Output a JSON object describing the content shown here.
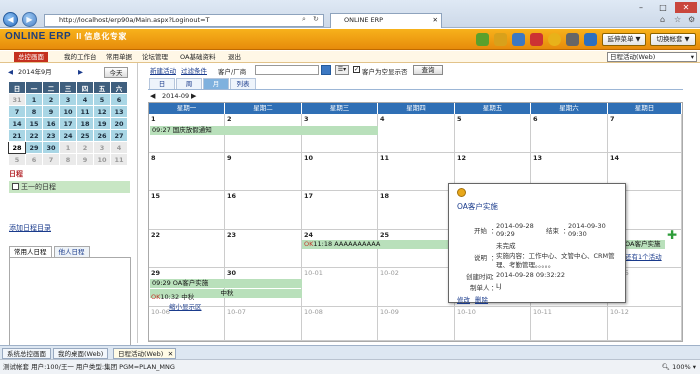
{
  "browser": {
    "url": "http://localhost/erp90a/Main.aspx?Loginout=T",
    "tab_title": "ONLINE ERP"
  },
  "app": {
    "logo_main": "ONLINE ERP",
    "logo_suffix": "II 信息化专家",
    "btn_extend": "延伸菜单 ▼",
    "btn_switch": "切换帐套 ▼",
    "accent": "#e88c0c"
  },
  "menu": {
    "items": [
      "总控画面",
      "我的工作台",
      "常用单据",
      "论坛管理",
      "OA基础资料",
      "退出"
    ],
    "view_select": "日程活动(Web)"
  },
  "minical": {
    "year_month": "2014年9月",
    "today": "今天",
    "prev": "◀",
    "next": "▶",
    "headers": [
      "日",
      "一",
      "二",
      "三",
      "四",
      "五",
      "六"
    ],
    "rows": [
      [
        "31",
        "1",
        "2",
        "3",
        "4",
        "5",
        "6"
      ],
      [
        "7",
        "8",
        "9",
        "10",
        "11",
        "12",
        "13"
      ],
      [
        "14",
        "15",
        "16",
        "17",
        "18",
        "19",
        "20"
      ],
      [
        "21",
        "22",
        "23",
        "24",
        "25",
        "26",
        "27"
      ],
      [
        "28",
        "29",
        "30",
        "1",
        "2",
        "3",
        "4"
      ],
      [
        "5",
        "6",
        "7",
        "8",
        "9",
        "10",
        "11"
      ]
    ]
  },
  "left": {
    "sched_title": "日程",
    "sched_item": "王一的日程",
    "add_dir": "添加日程目录",
    "tab_common": "常用人日程",
    "tab_others": "他人日程"
  },
  "toolbar": {
    "new_activity": "新建活动",
    "filter": "过滤条件",
    "customer_label": "客户/厂商",
    "empty_label": "客户为空显示否",
    "query": "查询",
    "tab_day": "日",
    "tab_week": "周",
    "tab_month": "月",
    "tab_list": "列表",
    "month": "2014-09"
  },
  "calendar": {
    "weekdays": [
      "星期一",
      "星期二",
      "星期三",
      "星期四",
      "星期五",
      "星期六",
      "星期日"
    ],
    "weeks": [
      [
        "1",
        "2",
        "3",
        "4",
        "5",
        "6",
        "7"
      ],
      [
        "8",
        "9",
        "10",
        "11",
        "12",
        "13",
        "14"
      ],
      [
        "15",
        "16",
        "17",
        "18",
        "19",
        "20",
        "21"
      ],
      [
        "22",
        "23",
        "24",
        "25",
        "26",
        "27",
        "28"
      ],
      [
        "29",
        "30",
        "10-01",
        "10-02",
        "10-03",
        "10-04",
        "10-05"
      ],
      [
        "10-06",
        "10-07",
        "10-08",
        "10-09",
        "10-10",
        "10-11",
        "10-12"
      ]
    ],
    "ev_week1": "09:27 国庆放假通知",
    "ev_week4_ok": "OK",
    "ev_week4_text": "11:18 AAAAAAAAAA",
    "ev_week4_right": "OA客户实施",
    "ev_week4_more": "还有1个活动",
    "ev_week5_a": "09:29 OA客户实施",
    "ev_week5_b": "中秋",
    "ev_week5_c_ok": "OK",
    "ev_week5_c": "10:32 中秋",
    "shrink": "缩小显示区"
  },
  "popup": {
    "title": "OA客户实施",
    "start_label": "开始",
    "start_date": "2014-09-28",
    "start_time": "09:29",
    "end_label": "结束",
    "end_date": "2014-09-30",
    "end_time": "09:30",
    "status": "未完成",
    "desc_label": "说明",
    "desc": "实施内容：工作中心、文管中心、CRM管理、考勤管理。。。。。",
    "created_label": "创建时间",
    "created": "2014-09-28 09:32:22",
    "creator_label": "制单人",
    "creator": "LJ",
    "edit": "修改",
    "delete": "删除"
  },
  "bottom_tabs": [
    "系统总控画面",
    "我的桌面(Web)",
    "日程活动(Web)"
  ],
  "status": {
    "left": "测试帐套    用户:100/王一    用户类型:集团    PGM=PLAN_MNG",
    "zoom": "100%"
  }
}
